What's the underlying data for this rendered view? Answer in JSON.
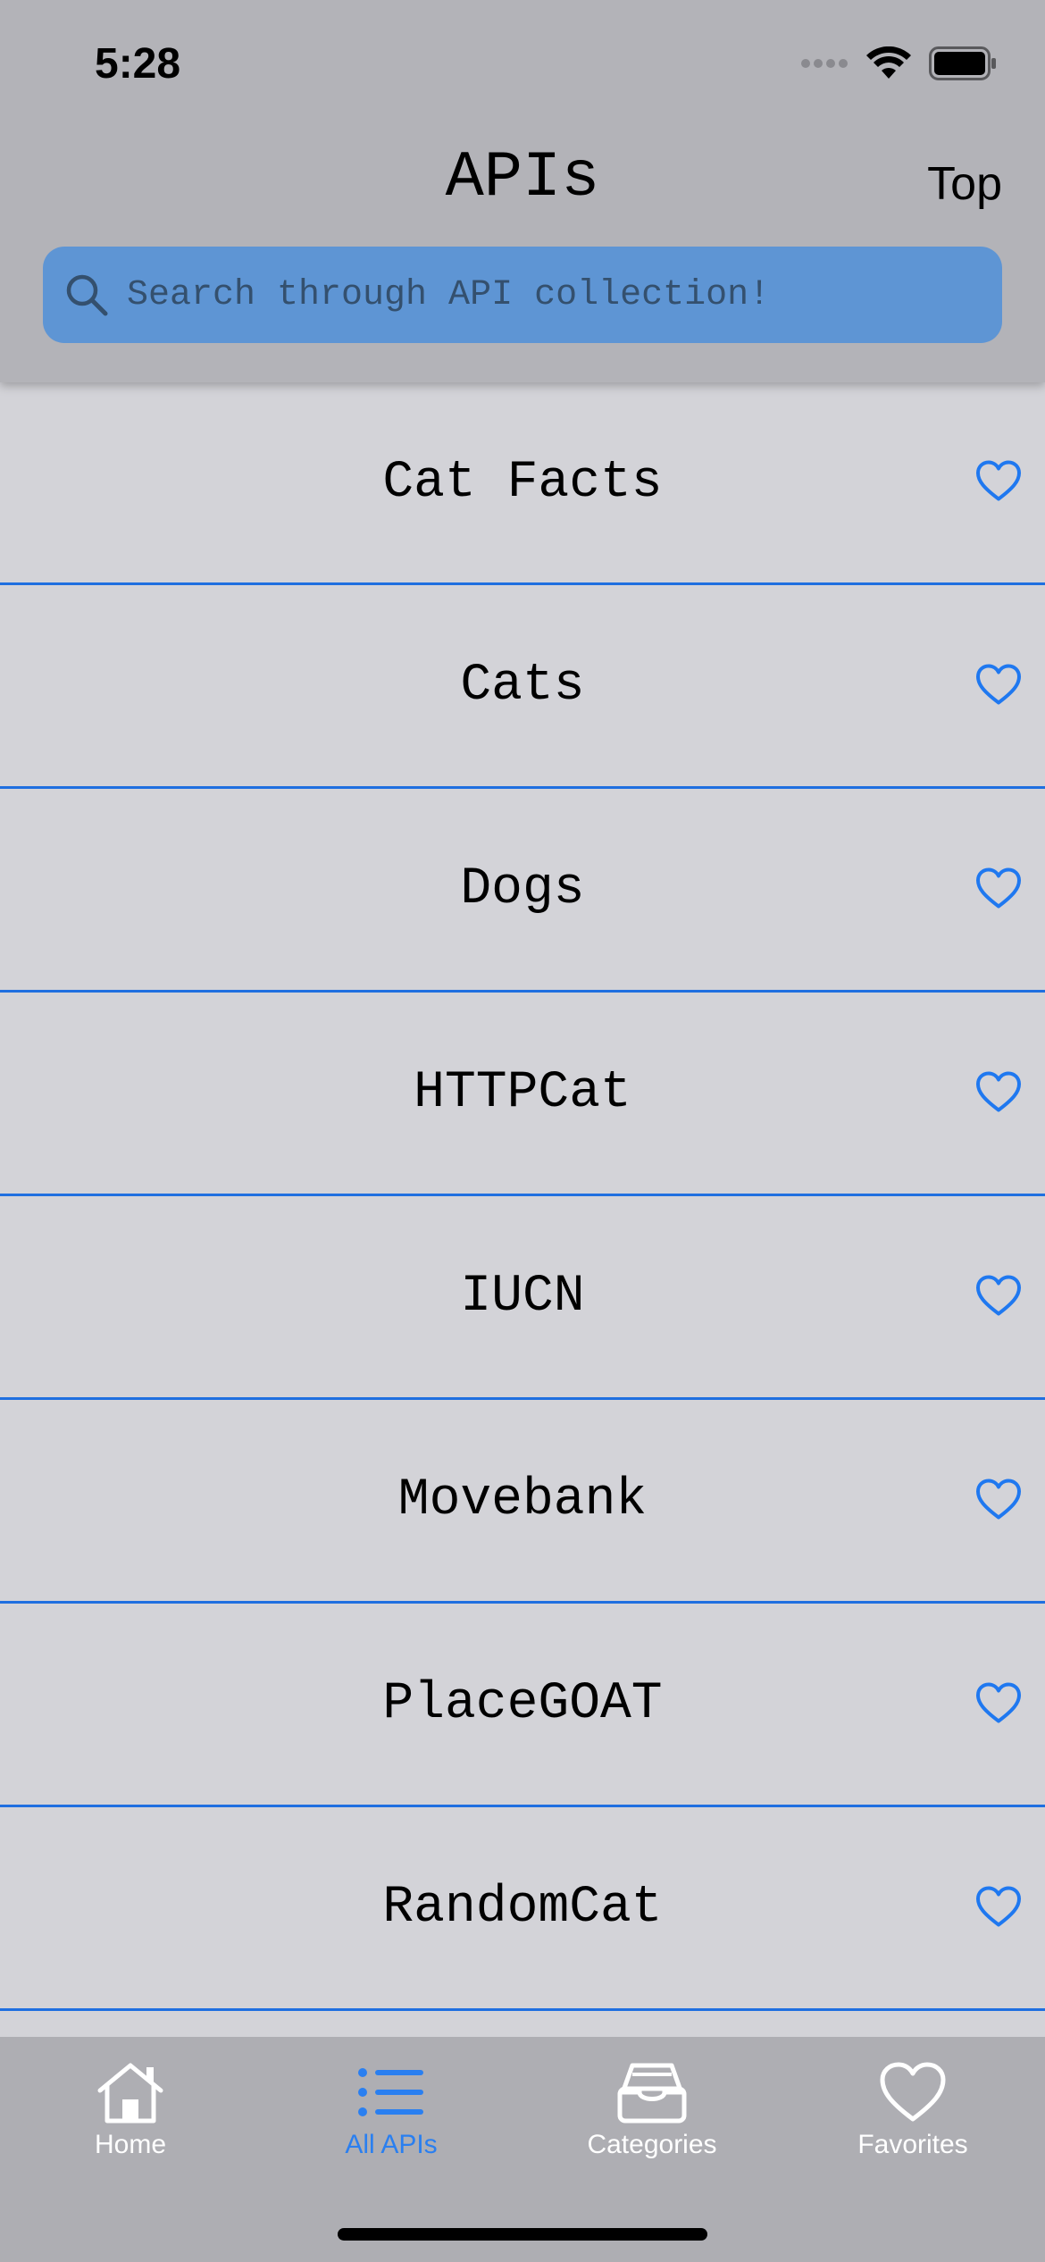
{
  "status_bar": {
    "time": "5:28"
  },
  "header": {
    "title": "APIs",
    "top_button": "Top"
  },
  "search": {
    "placeholder": "Search through API collection!",
    "value": ""
  },
  "api_list": [
    {
      "name": "Cat Facts"
    },
    {
      "name": "Cats"
    },
    {
      "name": "Dogs"
    },
    {
      "name": "HTTPCat"
    },
    {
      "name": "IUCN"
    },
    {
      "name": "Movebank"
    },
    {
      "name": "PlaceGOAT"
    },
    {
      "name": "RandomCat"
    }
  ],
  "tabs": [
    {
      "label": "Home",
      "icon": "house-icon",
      "active": false
    },
    {
      "label": "All APIs",
      "icon": "list-icon",
      "active": true
    },
    {
      "label": "Categories",
      "icon": "tray-icon",
      "active": false
    },
    {
      "label": "Favorites",
      "icon": "heart-icon",
      "active": false
    }
  ],
  "colors": {
    "accent": "#1f6fe0",
    "search_bg": "#5e95d4",
    "header_bg": "#b3b3b8",
    "list_bg": "#d3d3d8",
    "tab_bar_bg": "#aeaeb3"
  }
}
